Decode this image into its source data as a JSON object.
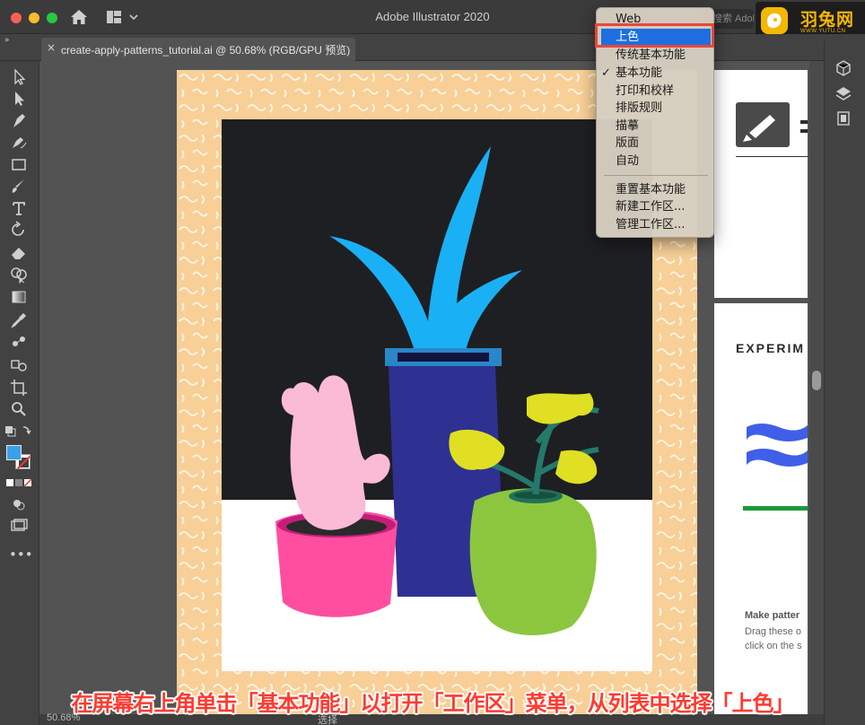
{
  "window": {
    "title": "Adobe Illustrator 2020"
  },
  "search": {
    "placeholder": "搜索 Adobe"
  },
  "logo": {
    "text": "羽兔网",
    "url": "WWW.YUTU.CN"
  },
  "document_tab": {
    "title": "create-apply-patterns_tutorial.ai @ 50.68% (RGB/GPU 预览)"
  },
  "workspace_menu": {
    "items": [
      {
        "label": "Web"
      },
      {
        "label": "上色",
        "selected": true
      },
      {
        "label": "传统基本功能"
      },
      {
        "label": "基本功能",
        "checked": true
      },
      {
        "label": "打印和校样"
      },
      {
        "label": "排版规则"
      },
      {
        "label": "描摹"
      },
      {
        "label": "版面"
      },
      {
        "label": "自动"
      },
      {
        "label": "重置基本功能"
      },
      {
        "label": "新建工作区..."
      },
      {
        "label": "管理工作区..."
      }
    ],
    "check_mark": "✓"
  },
  "side_panel": {
    "heading": "EXPERIM",
    "make_pattern": "Make patter",
    "drag_these": "Drag these o",
    "click_on": "click on the s"
  },
  "status": {
    "zoom": "50.68%",
    "tool": "选择"
  },
  "caption": {
    "text": "在屏幕右上角单击「基本功能」以打开「工作区」菜单，从列表中选择「上色」"
  },
  "colors": {
    "accent": "#1d6fe0",
    "highlight_border": "#e8463a",
    "fill_swatch": "#3aa0e9",
    "artboard_bg": "#f7cf97"
  },
  "toolbar": {
    "tools": [
      "selection-tool",
      "direct-selection-tool",
      "pen-tool",
      "curvature-tool",
      "rectangle-tool",
      "paintbrush-tool",
      "type-tool",
      "rotate-tool",
      "eraser-tool",
      "shape-builder-tool",
      "gradient-tool",
      "eyedropper-tool",
      "blend-tool",
      "symbol-sprayer-tool",
      "artboard-tool",
      "zoom-tool"
    ]
  }
}
